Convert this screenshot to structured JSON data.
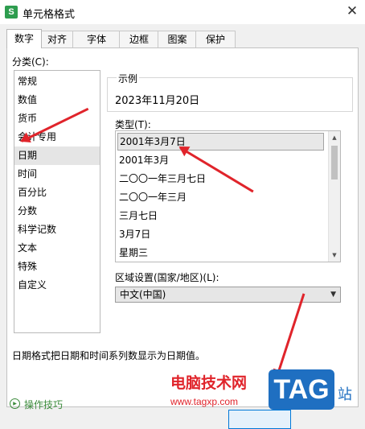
{
  "window": {
    "title": "单元格格式",
    "app_icon_letter": "S",
    "close_glyph": "✕"
  },
  "tabs": [
    {
      "label": "数字",
      "active": true
    },
    {
      "label": "对齐"
    },
    {
      "label": "字体"
    },
    {
      "label": "边框"
    },
    {
      "label": "图案"
    },
    {
      "label": "保护"
    }
  ],
  "category": {
    "label": "分类(C):",
    "items": [
      "常规",
      "数值",
      "货币",
      "会计专用",
      "日期",
      "时间",
      "百分比",
      "分数",
      "科学记数",
      "文本",
      "特殊",
      "自定义"
    ],
    "selected_index": 4
  },
  "sample": {
    "label": "示例",
    "value": "2023年11月20日"
  },
  "type": {
    "label": "类型(T):",
    "items": [
      "2001年3月7日",
      "2001年3月",
      "二〇〇一年三月七日",
      "二〇〇一年三月",
      "三月七日",
      "3月7日",
      "星期三"
    ],
    "selected_index": 0
  },
  "region": {
    "label": "区域设置(国家/地区)(L):",
    "value": "中文(中国)"
  },
  "description": "日期格式把日期和时间系列数显示为日期值。",
  "tips": {
    "label": "操作技巧"
  },
  "watermark": {
    "name": "电脑技术网",
    "url": "www.tagxp.com",
    "tag": "TAG",
    "station": "站"
  },
  "colors": {
    "annotation_arrow": "#e0242b",
    "tips_green": "#3a8a3a",
    "watermark_blue": "#1f6fc1"
  },
  "icons": {
    "scroll_up": "▲",
    "scroll_down": "▼",
    "dropdown": "▼"
  }
}
